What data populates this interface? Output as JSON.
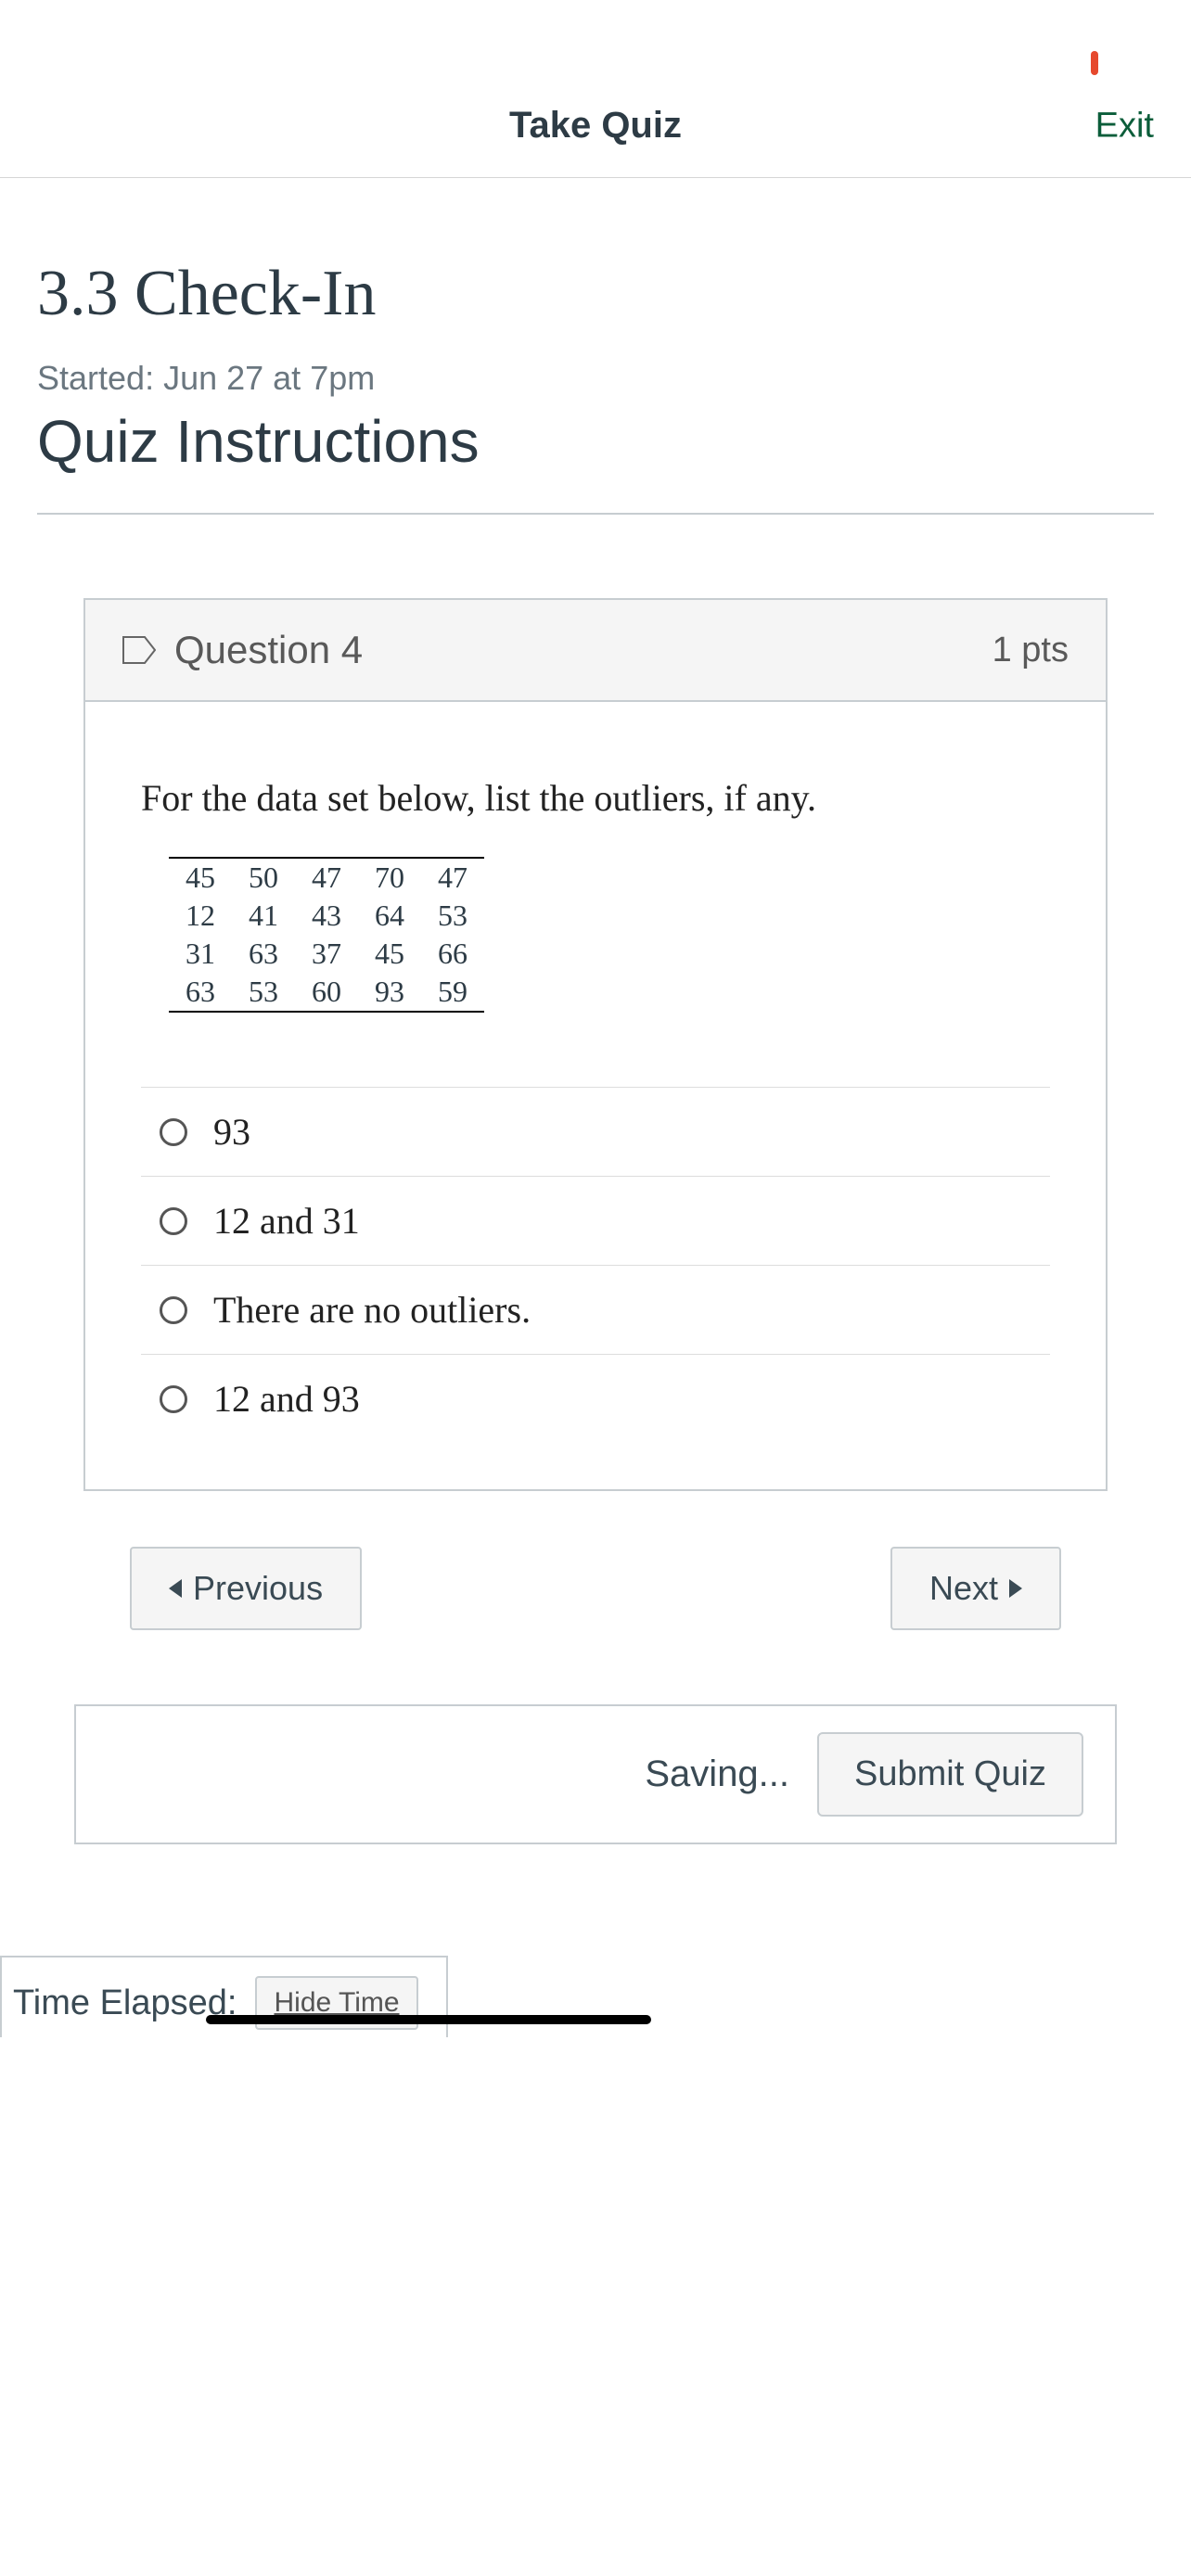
{
  "header": {
    "title": "Take Quiz",
    "exit": "Exit"
  },
  "quiz": {
    "title": "3.3 Check-In",
    "started": "Started: Jun 27 at 7pm",
    "instructions_heading": "Quiz Instructions"
  },
  "question": {
    "label": "Question 4",
    "points": "1 pts",
    "prompt": "For the data set below, list the outliers, if any.",
    "data_rows": [
      [
        "45",
        "50",
        "47",
        "70",
        "47"
      ],
      [
        "12",
        "41",
        "43",
        "64",
        "53"
      ],
      [
        "31",
        "63",
        "37",
        "45",
        "66"
      ],
      [
        "63",
        "53",
        "60",
        "93",
        "59"
      ]
    ],
    "options": [
      "93",
      "12 and 31",
      "There are no outliers.",
      "12 and 93"
    ]
  },
  "nav": {
    "previous": "Previous",
    "next": "Next"
  },
  "submit": {
    "saving": "Saving...",
    "button": "Submit Quiz"
  },
  "timer": {
    "label": "Time Elapsed:",
    "hide": "Hide Time"
  },
  "chart_data": {
    "type": "table",
    "title": "Data set",
    "rows": [
      [
        45,
        50,
        47,
        70,
        47
      ],
      [
        12,
        41,
        43,
        64,
        53
      ],
      [
        31,
        63,
        37,
        45,
        66
      ],
      [
        63,
        53,
        60,
        93,
        59
      ]
    ]
  }
}
